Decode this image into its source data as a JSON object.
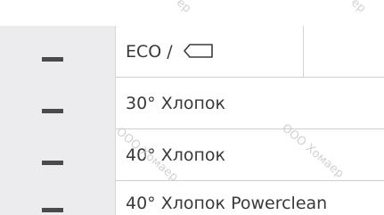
{
  "table": {
    "rows": [
      {
        "label": "ECO /"
      },
      {
        "label": "30° Хлопок"
      },
      {
        "label": "40° Хлопок"
      },
      {
        "label": "40° Хлопок Powerclean"
      }
    ]
  },
  "watermark": {
    "text": "ООО Хомаер",
    "fragment_top": "ер"
  },
  "icons": {
    "eco_row": "tray-outline-icon",
    "markers": "minus-dash-icon"
  }
}
